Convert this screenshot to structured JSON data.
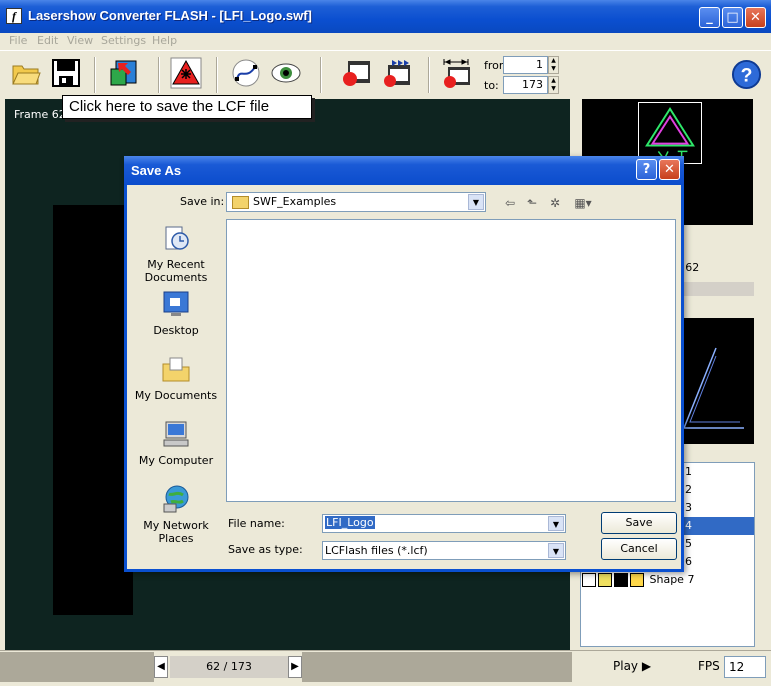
{
  "window": {
    "title": "Lasershow Converter FLASH - [LFI_Logo.swf]"
  },
  "menu": [
    "File",
    "Edit",
    "View",
    "Settings",
    "Help"
  ],
  "toolbar": {
    "from_label": "from:",
    "from_value": "1",
    "to_label": "to:",
    "to_value": "173"
  },
  "canvas": {
    "frame_label": "Frame 62,",
    "callout": "Click here to save the LCF file"
  },
  "right_panel": {
    "frame_strip": "o 62",
    "shapes": [
      "1",
      "2",
      "3",
      "4",
      "5",
      "6"
    ],
    "selected_index": 3,
    "shape7": "Shape 7"
  },
  "status": {
    "frame_counter": "62 / 173",
    "play_label": "Play",
    "fps_label": "FPS",
    "fps_value": "12"
  },
  "dialog": {
    "title": "Save As",
    "save_in_label": "Save in:",
    "save_in_value": "SWF_Examples",
    "places": [
      {
        "label": "My Recent Documents",
        "icon": "recent-documents-icon"
      },
      {
        "label": "Desktop",
        "icon": "desktop-icon"
      },
      {
        "label": "My Documents",
        "icon": "my-documents-icon"
      },
      {
        "label": "My Computer",
        "icon": "my-computer-icon"
      },
      {
        "label": "My Network Places",
        "icon": "network-places-icon"
      }
    ],
    "file_name_label": "File name:",
    "file_name_value": "LFI_Logo",
    "save_type_label": "Save as type:",
    "save_type_value": "LCFlash files (*.lcf)",
    "save_button": "Save",
    "cancel_button": "Cancel"
  },
  "colors": {
    "title_blue": "#0b4fd0",
    "canvas_bg": "#0e2420",
    "selection": "#316ac5",
    "laser_green": "#2ee86a",
    "laser_magenta": "#e040e0"
  }
}
